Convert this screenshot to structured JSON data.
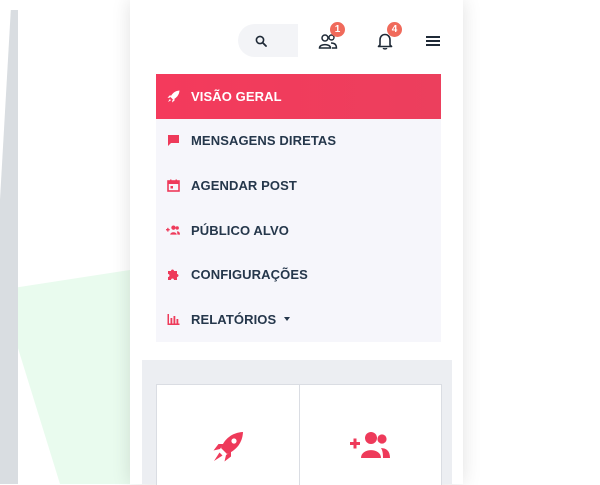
{
  "colors": {
    "accent": "#f43a5c",
    "badge": "#f06a5b",
    "menu_text": "#25374b",
    "menu_bg": "#f6f6fb",
    "bg_shape": "#e9fbee"
  },
  "header": {
    "search_icon": "search-icon",
    "audience_icon": "user-group-icon",
    "audience_badge": "1",
    "notifications_icon": "bell-icon",
    "notifications_badge": "4",
    "menu_icon": "hamburger-icon"
  },
  "menu": {
    "items": [
      {
        "label": "VISÃO GERAL",
        "icon": "rocket-icon",
        "active": true
      },
      {
        "label": "MENSAGENS DIRETAS",
        "icon": "message-icon",
        "active": false
      },
      {
        "label": "AGENDAR POST",
        "icon": "calendar-icon",
        "active": false
      },
      {
        "label": "PÚBLICO ALVO",
        "icon": "add-users-icon",
        "active": false
      },
      {
        "label": "CONFIGURAÇÕES",
        "icon": "puzzle-icon",
        "active": false
      },
      {
        "label": "RELATÓRIOS",
        "icon": "bar-chart-icon",
        "active": false,
        "has_dropdown": true
      }
    ]
  },
  "cards": [
    {
      "icon": "rocket-icon"
    },
    {
      "icon": "add-users-icon"
    }
  ]
}
